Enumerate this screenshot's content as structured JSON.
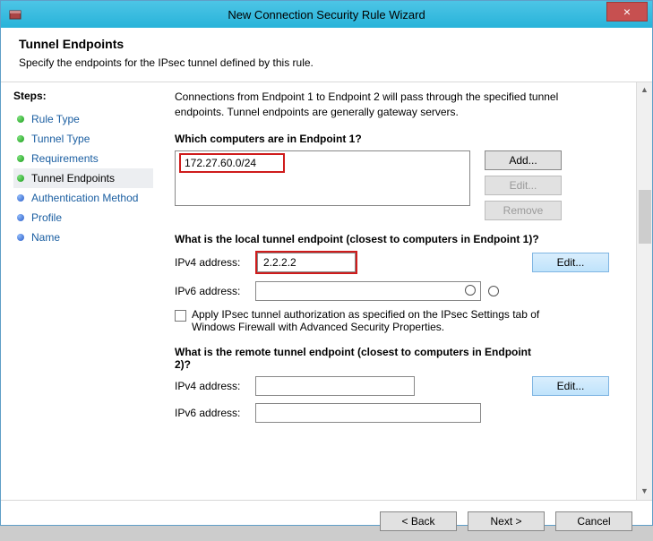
{
  "window": {
    "title": "New Connection Security Rule Wizard",
    "close": "×"
  },
  "header": {
    "title": "Tunnel Endpoints",
    "subtitle": "Specify the endpoints for the IPsec tunnel defined by this rule."
  },
  "sidebar": {
    "title": "Steps:",
    "items": [
      {
        "label": "Rule Type"
      },
      {
        "label": "Tunnel Type"
      },
      {
        "label": "Requirements"
      },
      {
        "label": "Tunnel Endpoints"
      },
      {
        "label": "Authentication Method"
      },
      {
        "label": "Profile"
      },
      {
        "label": "Name"
      }
    ]
  },
  "content": {
    "intro": "Connections from Endpoint 1 to Endpoint 2 will pass through the specified tunnel endpoints. Tunnel endpoints are generally gateway servers.",
    "ep1": {
      "question": "Which computers are in Endpoint 1?",
      "items": [
        "172.27.60.0/24"
      ],
      "add": "Add...",
      "edit": "Edit...",
      "remove": "Remove"
    },
    "local": {
      "question": "What is the local tunnel endpoint (closest to computers in Endpoint 1)?",
      "ipv4_label": "IPv4 address:",
      "ipv4_value": "2.2.2.2",
      "ipv6_label": "IPv6 address:",
      "ipv6_value": "",
      "edit": "Edit..."
    },
    "authz": {
      "label": "Apply IPsec tunnel authorization as specified on the IPsec Settings tab of Windows Firewall with Advanced Security Properties."
    },
    "remote": {
      "question": "What is the remote tunnel endpoint (closest to computers in Endpoint 2)?",
      "ipv4_label": "IPv4 address:",
      "ipv4_value": "",
      "ipv6_label": "IPv6 address:",
      "ipv6_value": "",
      "edit": "Edit..."
    }
  },
  "footer": {
    "back": "< Back",
    "next": "Next >",
    "cancel": "Cancel"
  }
}
